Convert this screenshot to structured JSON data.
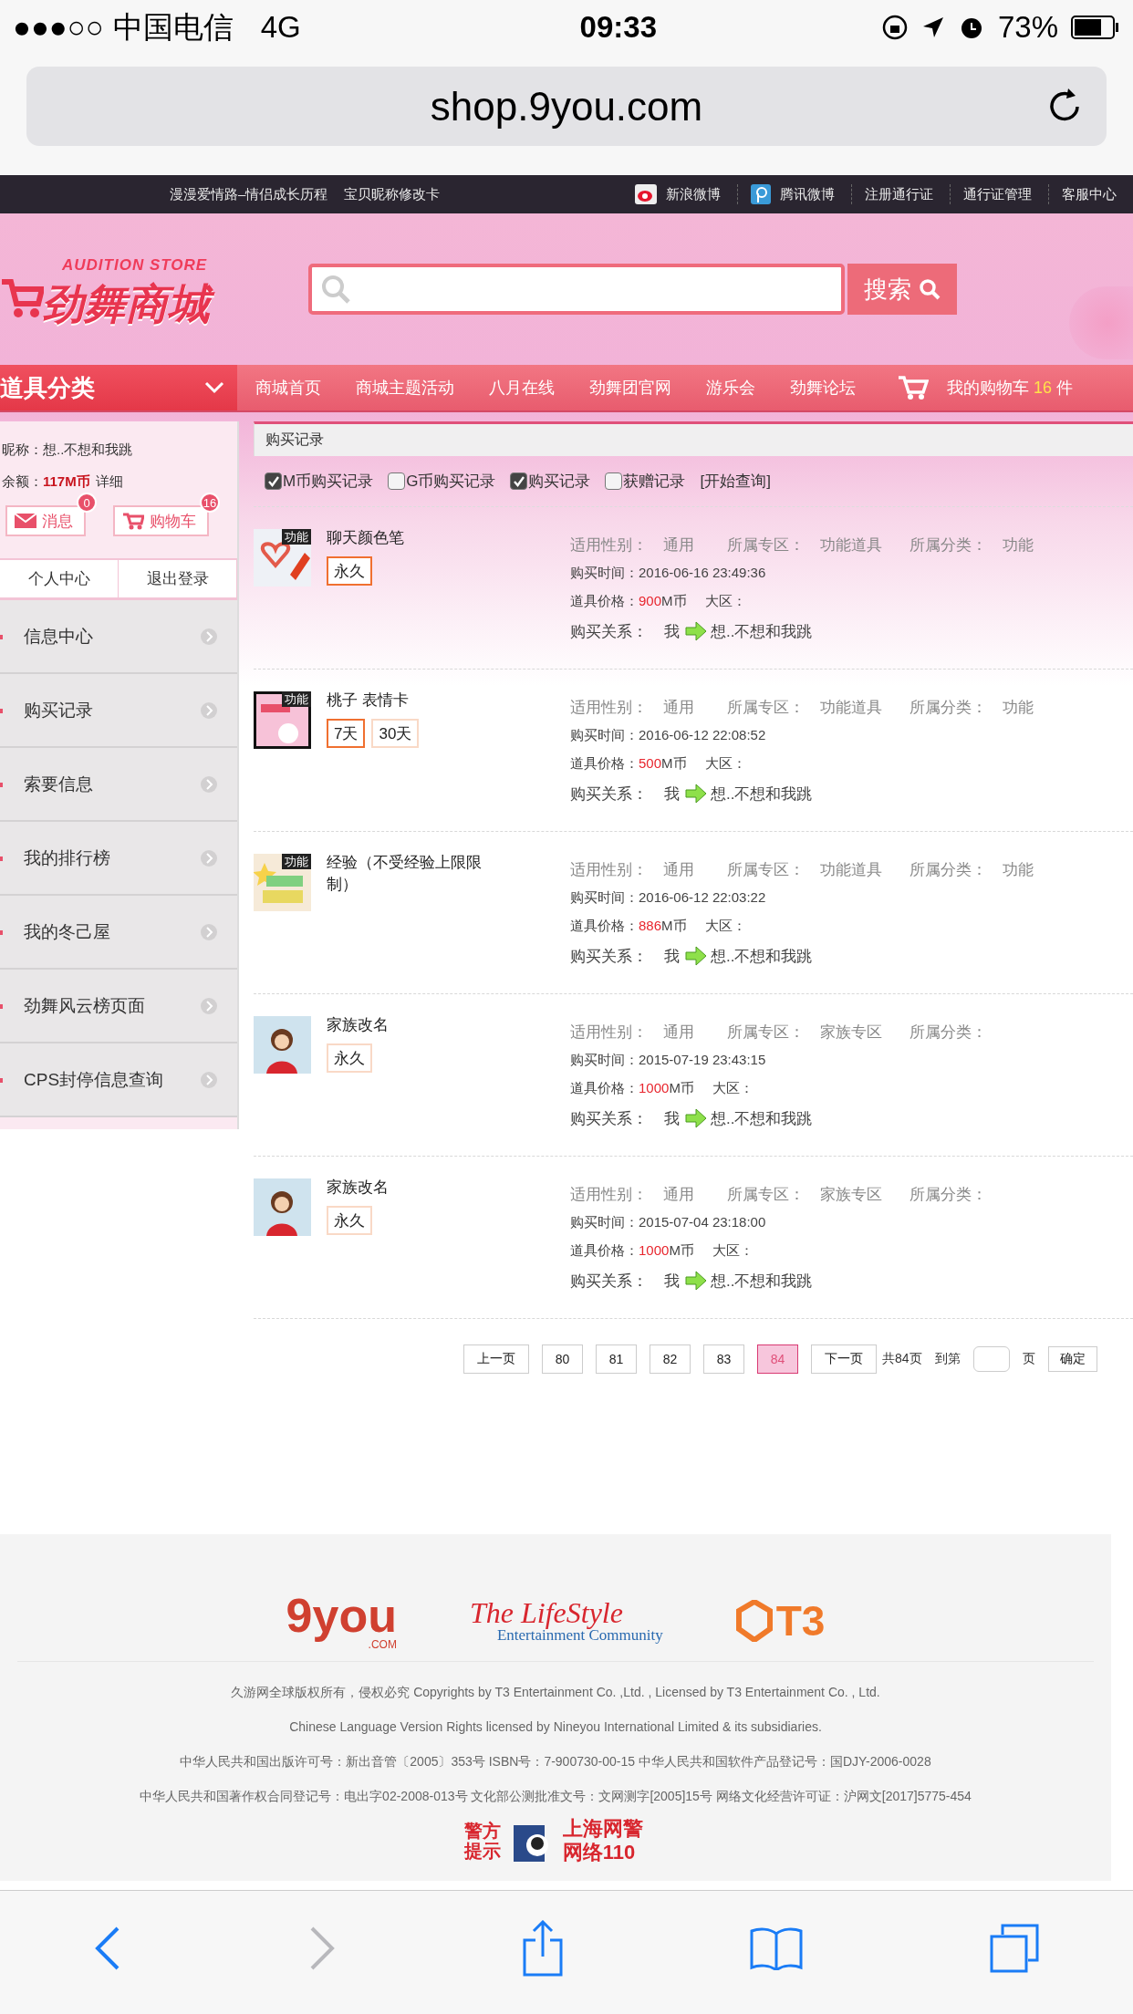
{
  "status_bar": {
    "signal": "●●●○○",
    "carrier": "中国电信",
    "network": "4G",
    "time": "09:33",
    "battery": "73%"
  },
  "browser": {
    "url": "shop.9you.com"
  },
  "top_bar": {
    "left_links": [
      "漫漫爱情路–情侣成长历程",
      "宝贝昵称修改卡"
    ],
    "right_links": [
      {
        "label": "新浪微博",
        "kind": "weibo"
      },
      {
        "label": "腾讯微博",
        "kind": "tencent"
      },
      {
        "label": "注册通行证",
        "kind": "plain"
      },
      {
        "label": "通行证管理",
        "kind": "plain"
      },
      {
        "label": "客服中心",
        "kind": "plain"
      }
    ]
  },
  "header": {
    "logo_tagline": "AUDITION STORE",
    "logo_title": "劲舞商城",
    "search_button": "搜索"
  },
  "nav": {
    "category": "道具分类",
    "items": [
      "商城首页",
      "商城主题活动",
      "八月在线",
      "劲舞团官网",
      "游乐会",
      "劲舞论坛"
    ],
    "cart_label": "我的购物车",
    "cart_count": "16",
    "cart_unit": "件"
  },
  "sidebar": {
    "nickname_label": "昵称：",
    "nickname": "想..不想和我跳",
    "balance_label": "余额：",
    "balance": "117M币",
    "detail_link": "详细",
    "message_button": "消息",
    "message_count": "0",
    "cart_button": "购物车",
    "cart_count": "16",
    "tabs": [
      "个人中心",
      "退出登录"
    ],
    "menu": [
      "信息中心",
      "购买记录",
      "索要信息",
      "我的排行榜",
      "我的冬己屋",
      "劲舞风云榜页面",
      "CPS封停信息查询"
    ]
  },
  "main": {
    "title": "购买记录",
    "filters": [
      {
        "label": "M币购买记录",
        "checked": true
      },
      {
        "label": "G币购买记录",
        "checked": false
      },
      {
        "label": "购买记录",
        "checked": true
      },
      {
        "label": "获赠记录",
        "checked": false
      }
    ],
    "query_link": "[开始查询]",
    "records": [
      {
        "name": "聊天颜色笔",
        "badge": "功能",
        "kind": "pen",
        "tags": [
          {
            "label": "永久",
            "selected": true
          }
        ],
        "fields": [
          {
            "label": "适用性别：",
            "value": "通用"
          },
          {
            "label": "所属专区：",
            "value": "功能道具"
          },
          {
            "label": "所属分类：",
            "value": "功能"
          }
        ],
        "time_label": "购买时间：",
        "time": "2016-06-16 23:49:36",
        "price_label": "道具价格：",
        "price": "900",
        "currency": "M币",
        "region_label": "大区：",
        "relation_label": "购买关系：",
        "buyer": "我",
        "recipient": "想..不想和我跳"
      },
      {
        "name": "桃子 表情卡",
        "badge": "功能",
        "kind": "card",
        "tags": [
          {
            "label": "7天",
            "selected": true
          },
          {
            "label": "30天",
            "selected": false
          }
        ],
        "fields": [
          {
            "label": "适用性别：",
            "value": "通用"
          },
          {
            "label": "所属专区：",
            "value": "功能道具"
          },
          {
            "label": "所属分类：",
            "value": "功能"
          }
        ],
        "time_label": "购买时间：",
        "time": "2016-06-12 22:08:52",
        "price_label": "道具价格：",
        "price": "500",
        "currency": "M币",
        "region_label": "大区：",
        "relation_label": "购买关系：",
        "buyer": "我",
        "recipient": "想..不想和我跳"
      },
      {
        "name": "经验（不受经验上限限制）",
        "badge": "功能",
        "kind": "exp",
        "fields": [
          {
            "label": "适用性别：",
            "value": "通用"
          },
          {
            "label": "所属专区：",
            "value": "功能道具"
          },
          {
            "label": "所属分类：",
            "value": "功能"
          }
        ],
        "time_label": "购买时间：",
        "time": "2016-06-12 22:03:22",
        "price_label": "道具价格：",
        "price": "886",
        "currency": "M币",
        "region_label": "大区：",
        "relation_label": "购买关系：",
        "buyer": "我",
        "recipient": "想..不想和我跳"
      },
      {
        "name": "家族改名",
        "kind": "character",
        "tags": [
          {
            "label": "永久",
            "selected": false
          }
        ],
        "fields": [
          {
            "label": "适用性别：",
            "value": "通用"
          },
          {
            "label": "所属专区：",
            "value": "家族专区"
          },
          {
            "label": "所属分类："
          }
        ],
        "time_label": "购买时间：",
        "time": "2015-07-19 23:43:15",
        "price_label": "道具价格：",
        "price": "1000",
        "currency": "M币",
        "region_label": "大区：",
        "relation_label": "购买关系：",
        "buyer": "我",
        "recipient": "想..不想和我跳"
      },
      {
        "name": "家族改名",
        "kind": "character",
        "tags": [
          {
            "label": "永久",
            "selected": false
          }
        ],
        "fields": [
          {
            "label": "适用性别：",
            "value": "通用"
          },
          {
            "label": "所属专区：",
            "value": "家族专区"
          },
          {
            "label": "所属分类："
          }
        ],
        "time_label": "购买时间：",
        "time": "2015-07-04 23:18:00",
        "price_label": "道具价格：",
        "price": "1000",
        "currency": "M币",
        "region_label": "大区：",
        "relation_label": "购买关系：",
        "buyer": "我",
        "recipient": "想..不想和我跳"
      }
    ]
  },
  "pagination": {
    "prev": "上一页",
    "pages": [
      {
        "label": "80",
        "selected": false
      },
      {
        "label": "81",
        "selected": false
      },
      {
        "label": "82",
        "selected": false
      },
      {
        "label": "83",
        "selected": false
      },
      {
        "label": "84",
        "selected": true
      }
    ],
    "next": "下一页",
    "total": "共84页",
    "goto_label": "到第",
    "goto_unit": "页",
    "confirm": "确定"
  },
  "footer": {
    "logos": [
      {
        "kind": "nineyou",
        "text": "9you",
        "sub": ".COM"
      },
      {
        "kind": "lifestyle",
        "text": "The LifeStyle",
        "sub": "Entertainment Community"
      },
      {
        "kind": "t3",
        "text": "T3"
      }
    ],
    "lines": [
      "久游网全球版权所有，侵权必究 Copyrights by T3 Entertainment Co. ,Ltd. , Licensed by T3 Entertainment Co. , Ltd.",
      "Chinese Language Version Rights licensed by Nineyou International Limited & its subsidiaries.",
      "中华人民共和国出版许可号：新出音管〔2005〕353号 ISBN号：7-900730-00-15 中华人民共和国软件产品登记号：国DJY-2006-0028",
      "中华人民共和国著作权合同登记号：电出字02-2008-013号 文化部公测批准文号：文网测字[2005]15号 网络文化经营许可证：沪网文[2017]5775-454"
    ],
    "police": {
      "notice": "警方提示",
      "title": "上海网警",
      "subtitle": "网络110"
    }
  },
  "toolbar": [
    {
      "kind": "back",
      "disabled": false
    },
    {
      "kind": "forward",
      "disabled": true
    },
    {
      "kind": "share",
      "disabled": false
    },
    {
      "kind": "bookmarks",
      "disabled": false
    },
    {
      "kind": "tabs",
      "disabled": false
    }
  ]
}
